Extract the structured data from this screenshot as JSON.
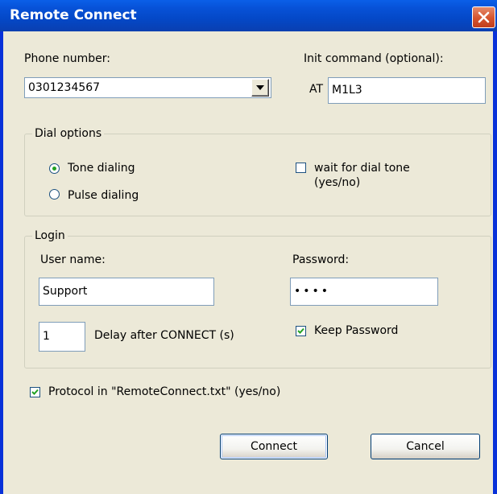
{
  "window": {
    "title": "Remote Connect"
  },
  "phone": {
    "label": "Phone number:",
    "value": "0301234567"
  },
  "init": {
    "label": "Init command (optional):",
    "prefix": "AT",
    "value": "M1L3"
  },
  "dial_options": {
    "title": "Dial options",
    "tone_label": "Tone dialing",
    "pulse_label": "Pulse dialing",
    "tone_selected": true,
    "wait_label_line1": "wait for dial tone",
    "wait_label_line2": "(yes/no)",
    "wait_checked": false
  },
  "login": {
    "title": "Login",
    "user_label": "User name:",
    "user_value": "Support",
    "password_label": "Password:",
    "password_value": "••••",
    "delay_value": "1",
    "delay_label": "Delay after CONNECT (s)",
    "keep_password_label": "Keep Password",
    "keep_password_checked": true
  },
  "protocol": {
    "label": "Protocol in \"RemoteConnect.txt\" (yes/no)",
    "checked": true
  },
  "buttons": {
    "connect": "Connect",
    "cancel": "Cancel"
  },
  "colors": {
    "titlebar": "#0a54e0",
    "client": "#ece9d8",
    "close": "#d5532d"
  }
}
